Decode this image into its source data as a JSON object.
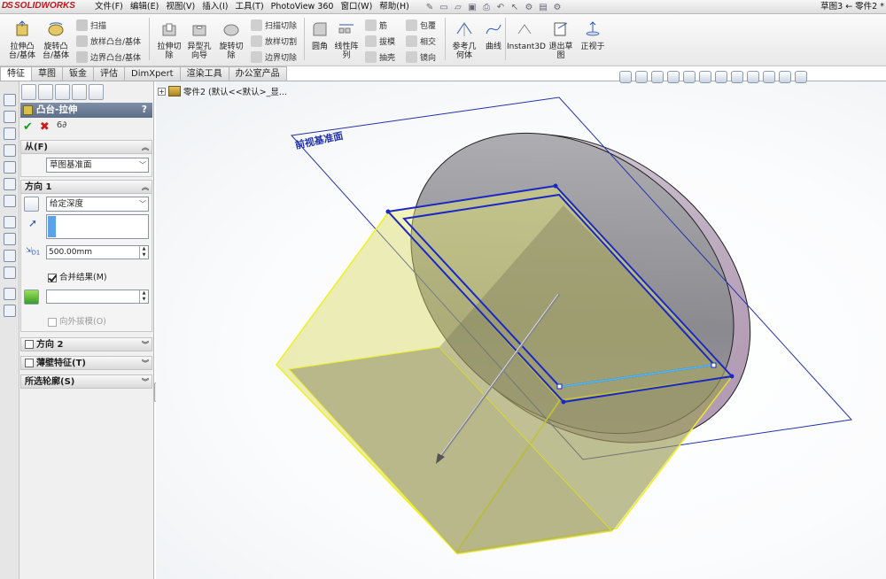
{
  "menubar": {
    "logo": "SOLIDWORKS",
    "items": [
      "文件(F)",
      "编辑(E)",
      "视图(V)",
      "插入(I)",
      "工具(T)",
      "PhotoView 360",
      "窗口(W)",
      "帮助(H)"
    ],
    "title": "草图3 ← 零件2 *"
  },
  "toolbar": {
    "extrude_boss": "拉伸凸\n台/基体",
    "revolve_boss": "旋转凸\n台/基体",
    "sweep": "扫描",
    "loft_boss": "放样凸台/基体",
    "boundary_boss": "边界凸台/基体",
    "extrude_cut": "拉伸切\n除",
    "hole_wizard": "异型孔\n向导",
    "revolve_cut": "旋转切\n除",
    "swept_cut": "扫描切除",
    "lofted_cut": "放样切割",
    "boundary_cut": "边界切除",
    "fillet": "圆角",
    "linear_pattern": "线性阵\n列",
    "rib": "筋",
    "draft": "拔模",
    "shell": "抽壳",
    "wrap": "包覆",
    "intersect": "相交",
    "mirror": "镜向",
    "ref_geometry": "参考几\n何体",
    "curves": "曲线",
    "instant3d": "Instant3D",
    "exit_sketch": "退出草\n图",
    "normal_to": "正视于"
  },
  "tabs": [
    "特征",
    "草图",
    "钣金",
    "评估",
    "DimXpert",
    "渲染工具",
    "办公室产品"
  ],
  "active_tab": "特征",
  "property_manager": {
    "title": "凸台-拉伸",
    "help": "?",
    "ok": "✔",
    "cancel": "✖",
    "detail": "6∂",
    "from": {
      "header": "从(F)",
      "value": "草图基准面"
    },
    "direction1": {
      "header": "方向 1",
      "end_condition": "给定深度",
      "depth": "500.00mm",
      "merge_result": "合并结果(M)",
      "merge_checked": true,
      "draft_outward": "向外拔模(O)",
      "draft_outward_checked": false
    },
    "direction2": {
      "header": "方向 2",
      "checked": false
    },
    "thin_feature": {
      "header": "薄壁特征(T)",
      "checked": false
    },
    "selected_contours": {
      "header": "所选轮廓(S)"
    }
  },
  "feature_tree": {
    "part": "零件2",
    "config": "(默认<<默认>_显..."
  },
  "scene": {
    "plane_label": "前视基准面",
    "plane_color": "#2233aa",
    "extrude_fill": "#e8e86a",
    "extrude_edge": "#f0f020",
    "sketch_color": "#1a28c8",
    "disc_fill": "#8a8a8e"
  }
}
